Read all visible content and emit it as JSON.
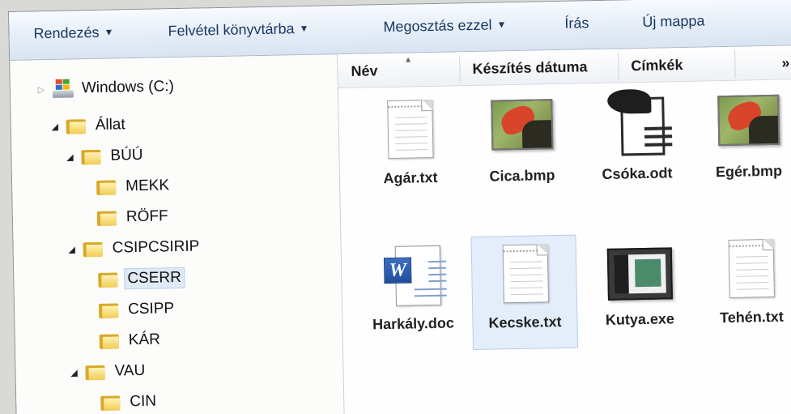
{
  "toolbar": {
    "organize": "Rendezés",
    "include_library": "Felvétel könyvtárba",
    "share_with": "Megosztás ezzel",
    "burn": "Írás",
    "new_folder": "Új mappa"
  },
  "tree": {
    "drive": "Windows (C:)",
    "allat": "Állat",
    "buu": "BÚÚ",
    "mekk": "MEKK",
    "roff": "RÖFF",
    "csipcsirip": "CSIPCSIRIP",
    "cserr": "CSERR",
    "csipp": "CSIPP",
    "kar": "KÁR",
    "vau": "VAU",
    "cin": "CIN"
  },
  "columns": {
    "name": "Név",
    "date": "Készítés dátuma",
    "tags": "Címkék",
    "more": "»"
  },
  "files": {
    "agar": "Agár.txt",
    "cica": "Cica.bmp",
    "csoka": "Csóka.odt",
    "eger": "Egér.bmp",
    "harkaly": "Harkály.doc",
    "kecske": "Kecske.txt",
    "kutya": "Kutya.exe",
    "tehen": "Tehén.txt"
  },
  "colors": {
    "toolbar_text": "#17375e",
    "selection": "#dfeaf7",
    "folder": "#f2cc54"
  }
}
